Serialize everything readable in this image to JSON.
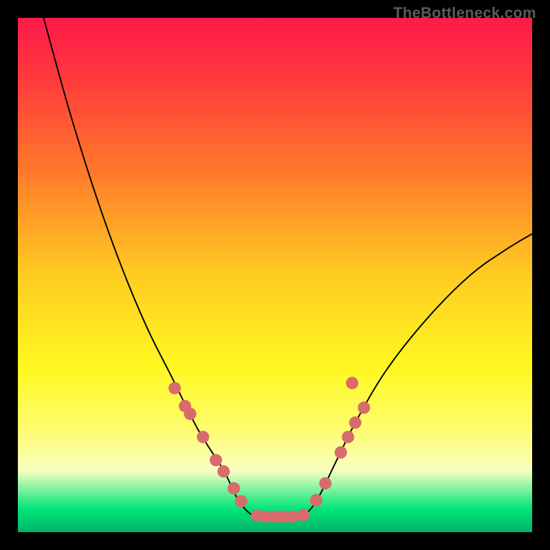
{
  "watermark": "TheBottleneck.com",
  "chart_data": {
    "type": "line",
    "title": "",
    "xlabel": "",
    "ylabel": "",
    "xlim": [
      0,
      100
    ],
    "ylim": [
      0,
      100
    ],
    "background": {
      "type": "vertical-gradient",
      "stops": [
        {
          "offset": 0.0,
          "color": "#ff1a4a"
        },
        {
          "offset": 0.12,
          "color": "#ff3b3b"
        },
        {
          "offset": 0.3,
          "color": "#ff7a2a"
        },
        {
          "offset": 0.5,
          "color": "#ffcc22"
        },
        {
          "offset": 0.68,
          "color": "#fff820"
        },
        {
          "offset": 0.8,
          "color": "#fffc70"
        },
        {
          "offset": 0.88,
          "color": "#f8ffc0"
        },
        {
          "offset": 0.955,
          "color": "#00e57a"
        },
        {
          "offset": 1.0,
          "color": "#00b46a"
        }
      ]
    },
    "series": [
      {
        "name": "curve",
        "type": "path",
        "color": "#000000",
        "width": 2,
        "points": [
          {
            "x": 5,
            "y": 100
          },
          {
            "x": 10,
            "y": 82
          },
          {
            "x": 15,
            "y": 66
          },
          {
            "x": 20,
            "y": 52
          },
          {
            "x": 25,
            "y": 40
          },
          {
            "x": 30,
            "y": 30
          },
          {
            "x": 35,
            "y": 20
          },
          {
            "x": 40,
            "y": 12
          },
          {
            "x": 43,
            "y": 6
          },
          {
            "x": 46,
            "y": 3
          },
          {
            "x": 48,
            "y": 3
          },
          {
            "x": 52,
            "y": 3
          },
          {
            "x": 55,
            "y": 3
          },
          {
            "x": 58,
            "y": 6
          },
          {
            "x": 62,
            "y": 14
          },
          {
            "x": 66,
            "y": 22
          },
          {
            "x": 72,
            "y": 32
          },
          {
            "x": 80,
            "y": 42
          },
          {
            "x": 88,
            "y": 50
          },
          {
            "x": 95,
            "y": 55
          },
          {
            "x": 100,
            "y": 58
          }
        ]
      }
    ],
    "markers": {
      "color": "#d86b6b",
      "radius": 9,
      "points": [
        {
          "x": 30.5,
          "y": 28
        },
        {
          "x": 32.5,
          "y": 24.5
        },
        {
          "x": 33.5,
          "y": 23
        },
        {
          "x": 36,
          "y": 18.5
        },
        {
          "x": 38.5,
          "y": 14
        },
        {
          "x": 40,
          "y": 11.8
        },
        {
          "x": 42,
          "y": 8.5
        },
        {
          "x": 43.4,
          "y": 6
        },
        {
          "x": 46.5,
          "y": 3.2
        },
        {
          "x": 48.3,
          "y": 3.0
        },
        {
          "x": 50,
          "y": 3.0
        },
        {
          "x": 51.7,
          "y": 3.0
        },
        {
          "x": 53.4,
          "y": 3.0
        },
        {
          "x": 55.5,
          "y": 3.3
        },
        {
          "x": 58,
          "y": 6.2
        },
        {
          "x": 59.8,
          "y": 9.5
        },
        {
          "x": 62.8,
          "y": 15.5
        },
        {
          "x": 64.2,
          "y": 18.5
        },
        {
          "x": 65.6,
          "y": 21.3
        },
        {
          "x": 67.3,
          "y": 24.2
        },
        {
          "x": 65,
          "y": 29
        }
      ]
    }
  }
}
